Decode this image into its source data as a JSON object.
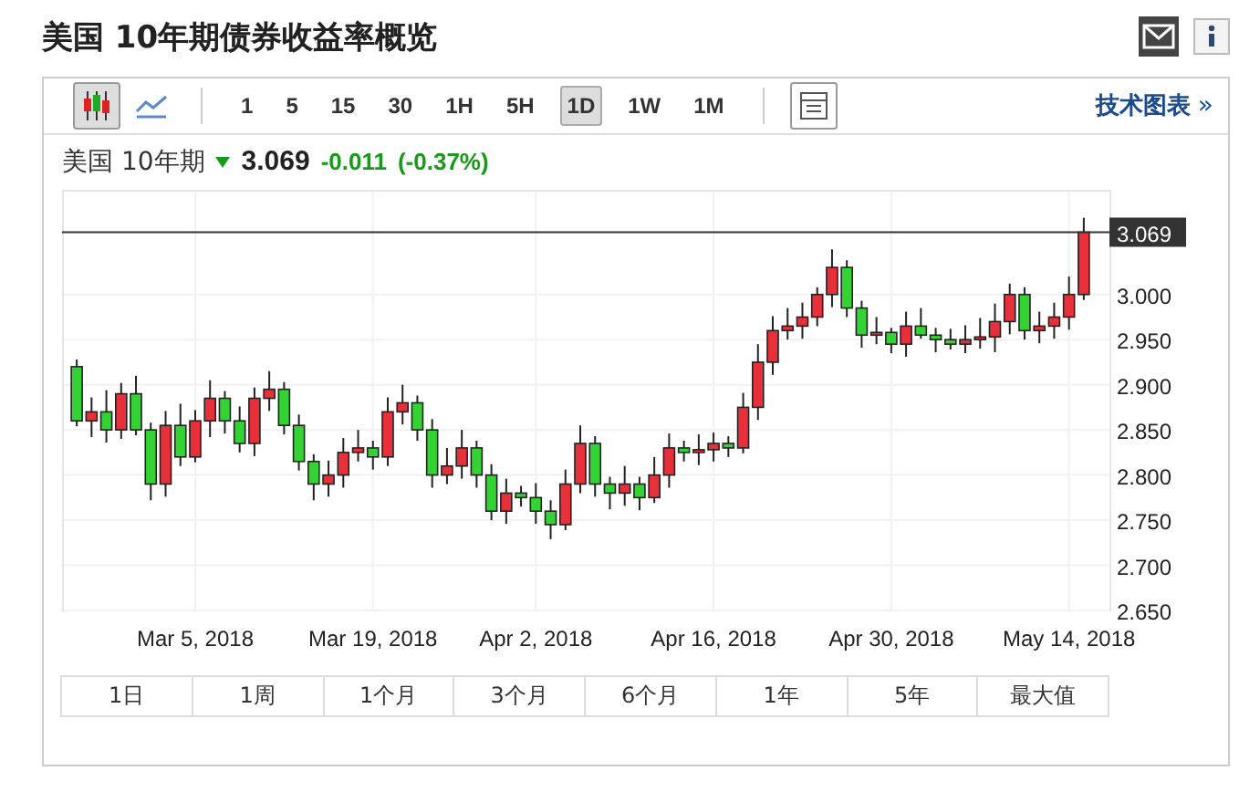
{
  "header": {
    "title": "美国 10年期债券收益率概览"
  },
  "toolbar": {
    "chart_types": [
      {
        "kind": "candle",
        "selected": true
      },
      {
        "kind": "line",
        "selected": false
      }
    ],
    "intervals": [
      {
        "label": "1",
        "selected": false
      },
      {
        "label": "5",
        "selected": false
      },
      {
        "label": "15",
        "selected": false
      },
      {
        "label": "30",
        "selected": false
      },
      {
        "label": "1H",
        "selected": false
      },
      {
        "label": "5H",
        "selected": false
      },
      {
        "label": "1D",
        "selected": true
      },
      {
        "label": "1W",
        "selected": false
      },
      {
        "label": "1M",
        "selected": false
      }
    ],
    "link": "技术图表",
    "link_arrow": "»"
  },
  "quote": {
    "name": "美国 10年期",
    "falling": true,
    "price": "3.069",
    "change": "-0.011",
    "change_percent": "(-0.37%)"
  },
  "chart": {
    "chart_data": {
      "type": "candlestick",
      "categories": [
        null,
        null,
        null,
        null,
        null,
        null,
        null,
        null,
        "Mar 5, 2018",
        null,
        null,
        null,
        null,
        null,
        null,
        null,
        null,
        null,
        null,
        null,
        "Mar 19, 2018",
        null,
        null,
        null,
        null,
        null,
        null,
        null,
        null,
        null,
        null,
        "Apr 2, 2018",
        null,
        null,
        null,
        null,
        null,
        null,
        null,
        null,
        null,
        null,
        null,
        "Apr 16, 2018",
        null,
        null,
        null,
        null,
        null,
        null,
        null,
        null,
        null,
        null,
        null,
        "Apr 30, 2018",
        null,
        null,
        null,
        null,
        null,
        null,
        null,
        null,
        null,
        null,
        null,
        "May 14, 2018",
        null
      ],
      "ohlc": [
        [
          2.92,
          2.928,
          2.854,
          2.86
        ],
        [
          2.86,
          2.886,
          2.842,
          2.87
        ],
        [
          2.87,
          2.894,
          2.836,
          2.85
        ],
        [
          2.85,
          2.902,
          2.84,
          2.89
        ],
        [
          2.89,
          2.91,
          2.844,
          2.85
        ],
        [
          2.85,
          2.858,
          2.772,
          2.79
        ],
        [
          2.79,
          2.871,
          2.776,
          2.855
        ],
        [
          2.855,
          2.879,
          2.81,
          2.82
        ],
        [
          2.82,
          2.872,
          2.814,
          2.86
        ],
        [
          2.86,
          2.905,
          2.842,
          2.885
        ],
        [
          2.885,
          2.893,
          2.846,
          2.86
        ],
        [
          2.86,
          2.876,
          2.825,
          2.835
        ],
        [
          2.835,
          2.897,
          2.821,
          2.885
        ],
        [
          2.885,
          2.915,
          2.871,
          2.895
        ],
        [
          2.895,
          2.903,
          2.845,
          2.855
        ],
        [
          2.855,
          2.867,
          2.805,
          2.815
        ],
        [
          2.815,
          2.823,
          2.772,
          2.79
        ],
        [
          2.79,
          2.816,
          2.776,
          2.8
        ],
        [
          2.8,
          2.841,
          2.786,
          2.825
        ],
        [
          2.825,
          2.85,
          2.815,
          2.83
        ],
        [
          2.83,
          2.838,
          2.806,
          2.82
        ],
        [
          2.82,
          2.886,
          2.81,
          2.87
        ],
        [
          2.87,
          2.9,
          2.856,
          2.88
        ],
        [
          2.88,
          2.888,
          2.838,
          2.85
        ],
        [
          2.85,
          2.862,
          2.786,
          2.8
        ],
        [
          2.8,
          2.83,
          2.79,
          2.81
        ],
        [
          2.81,
          2.85,
          2.796,
          2.83
        ],
        [
          2.83,
          2.838,
          2.786,
          2.8
        ],
        [
          2.8,
          2.812,
          2.75,
          2.76
        ],
        [
          2.76,
          2.796,
          2.746,
          2.78
        ],
        [
          2.78,
          2.788,
          2.765,
          2.775
        ],
        [
          2.775,
          2.791,
          2.746,
          2.76
        ],
        [
          2.76,
          2.772,
          2.729,
          2.745
        ],
        [
          2.745,
          2.806,
          2.739,
          2.79
        ],
        [
          2.79,
          2.855,
          2.78,
          2.835
        ],
        [
          2.835,
          2.843,
          2.776,
          2.79
        ],
        [
          2.79,
          2.798,
          2.762,
          2.78
        ],
        [
          2.78,
          2.81,
          2.766,
          2.79
        ],
        [
          2.79,
          2.798,
          2.761,
          2.775
        ],
        [
          2.775,
          2.82,
          2.769,
          2.8
        ],
        [
          2.8,
          2.846,
          2.786,
          2.83
        ],
        [
          2.83,
          2.838,
          2.815,
          2.825
        ],
        [
          2.825,
          2.845,
          2.811,
          2.828
        ],
        [
          2.828,
          2.847,
          2.815,
          2.835
        ],
        [
          2.835,
          2.843,
          2.82,
          2.83
        ],
        [
          2.83,
          2.891,
          2.824,
          2.875
        ],
        [
          2.875,
          2.945,
          2.861,
          2.925
        ],
        [
          2.925,
          2.976,
          2.911,
          2.96
        ],
        [
          2.96,
          2.985,
          2.95,
          2.965
        ],
        [
          2.965,
          2.991,
          2.951,
          2.975
        ],
        [
          2.975,
          3.008,
          2.965,
          3.0
        ],
        [
          3.0,
          3.05,
          2.986,
          3.03
        ],
        [
          3.03,
          3.038,
          2.975,
          2.985
        ],
        [
          2.985,
          2.993,
          2.941,
          2.955
        ],
        [
          2.955,
          2.975,
          2.945,
          2.958
        ],
        [
          2.958,
          2.963,
          2.935,
          2.945
        ],
        [
          2.945,
          2.981,
          2.931,
          2.965
        ],
        [
          2.965,
          2.985,
          2.951,
          2.955
        ],
        [
          2.955,
          2.963,
          2.936,
          2.95
        ],
        [
          2.95,
          2.962,
          2.939,
          2.945
        ],
        [
          2.945,
          2.966,
          2.935,
          2.95
        ],
        [
          2.95,
          2.974,
          2.94,
          2.953
        ],
        [
          2.953,
          2.99,
          2.936,
          2.97
        ],
        [
          2.97,
          3.012,
          2.956,
          3.0
        ],
        [
          3.0,
          3.008,
          2.95,
          2.96
        ],
        [
          2.96,
          2.981,
          2.946,
          2.965
        ],
        [
          2.965,
          2.991,
          2.951,
          2.975
        ],
        [
          2.975,
          3.02,
          2.961,
          3.0
        ],
        [
          3.0,
          3.085,
          2.994,
          3.069
        ]
      ],
      "ylim": [
        2.65,
        3.115
      ],
      "grid": true,
      "ref_lines": [
        {
          "axis": "y",
          "value": 3.069,
          "label": "3.069"
        }
      ],
      "yticks": [
        {
          "value": 3.0,
          "label": "3.000"
        },
        {
          "value": 2.95,
          "label": "2.950"
        },
        {
          "value": 2.9,
          "label": "2.900"
        },
        {
          "value": 2.85,
          "label": "2.850"
        },
        {
          "value": 2.8,
          "label": "2.800"
        },
        {
          "value": 2.75,
          "label": "2.750"
        },
        {
          "value": 2.7,
          "label": "2.700"
        },
        {
          "value": 2.65,
          "label": "2.650"
        }
      ]
    }
  },
  "ranges": [
    "1日",
    "1周",
    "1个月",
    "3个月",
    "6个月",
    "1年",
    "5年",
    "最大值"
  ]
}
